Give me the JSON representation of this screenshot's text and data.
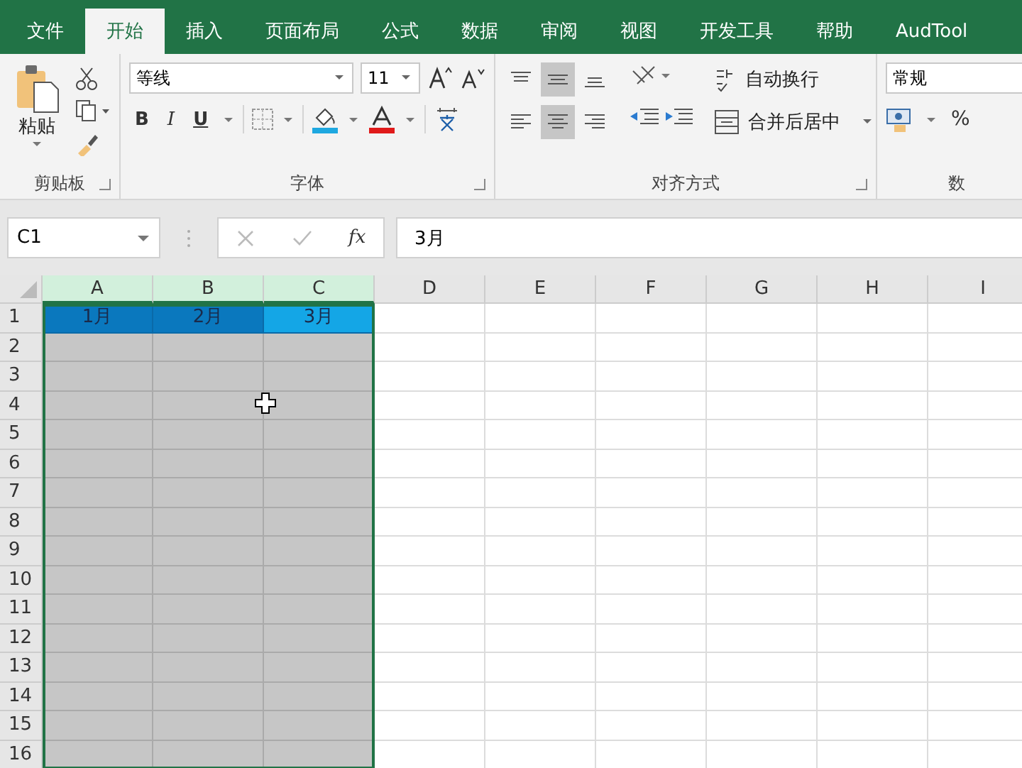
{
  "tabs": [
    {
      "label": "文件",
      "selected": false
    },
    {
      "label": "开始",
      "selected": true
    },
    {
      "label": "插入",
      "selected": false
    },
    {
      "label": "页面布局",
      "selected": false
    },
    {
      "label": "公式",
      "selected": false
    },
    {
      "label": "数据",
      "selected": false
    },
    {
      "label": "审阅",
      "selected": false
    },
    {
      "label": "视图",
      "selected": false
    },
    {
      "label": "开发工具",
      "selected": false
    },
    {
      "label": "帮助",
      "selected": false
    },
    {
      "label": "AudTool",
      "selected": false
    }
  ],
  "ribbon": {
    "clipboard": {
      "paste_label": "粘贴",
      "group_label": "剪贴板"
    },
    "font": {
      "font_name": "等线",
      "font_size": "11",
      "bold": "B",
      "italic": "I",
      "underline": "U",
      "group_label": "字体"
    },
    "alignment": {
      "vertical": [
        {
          "kind": "top",
          "selected": false
        },
        {
          "kind": "middle",
          "selected": true
        },
        {
          "kind": "bottom",
          "selected": false
        }
      ],
      "horizontal": [
        {
          "kind": "left",
          "selected": false
        },
        {
          "kind": "center",
          "selected": true
        },
        {
          "kind": "right",
          "selected": false
        }
      ],
      "wrap_text": "自动换行",
      "merge_center": "合并后居中",
      "group_label": "对齐方式"
    },
    "number": {
      "format": "常规",
      "percent": "%",
      "group_label": "数"
    }
  },
  "formula_bar": {
    "name_box": "C1",
    "fx": "fx",
    "value": "3月"
  },
  "sheet": {
    "columns": [
      {
        "label": "A",
        "selected": true
      },
      {
        "label": "B",
        "selected": true
      },
      {
        "label": "C",
        "selected": true
      },
      {
        "label": "D",
        "selected": false
      },
      {
        "label": "E",
        "selected": false
      },
      {
        "label": "F",
        "selected": false
      },
      {
        "label": "G",
        "selected": false
      },
      {
        "label": "H",
        "selected": false
      },
      {
        "label": "I",
        "selected": false
      }
    ],
    "rows": [
      {
        "label": "1",
        "cells": [
          {
            "text": "1月",
            "color": "#0a78be"
          },
          {
            "text": "2月",
            "color": "#0a78be"
          },
          {
            "text": "3月",
            "color": "#14a6e6"
          }
        ]
      },
      {
        "label": "2"
      },
      {
        "label": "3"
      },
      {
        "label": "4"
      },
      {
        "label": "5"
      },
      {
        "label": "6"
      },
      {
        "label": "7"
      },
      {
        "label": "8"
      },
      {
        "label": "9"
      },
      {
        "label": "10"
      },
      {
        "label": "11"
      },
      {
        "label": "12"
      },
      {
        "label": "13"
      },
      {
        "label": "14"
      },
      {
        "label": "15"
      },
      {
        "label": "16"
      }
    ]
  }
}
